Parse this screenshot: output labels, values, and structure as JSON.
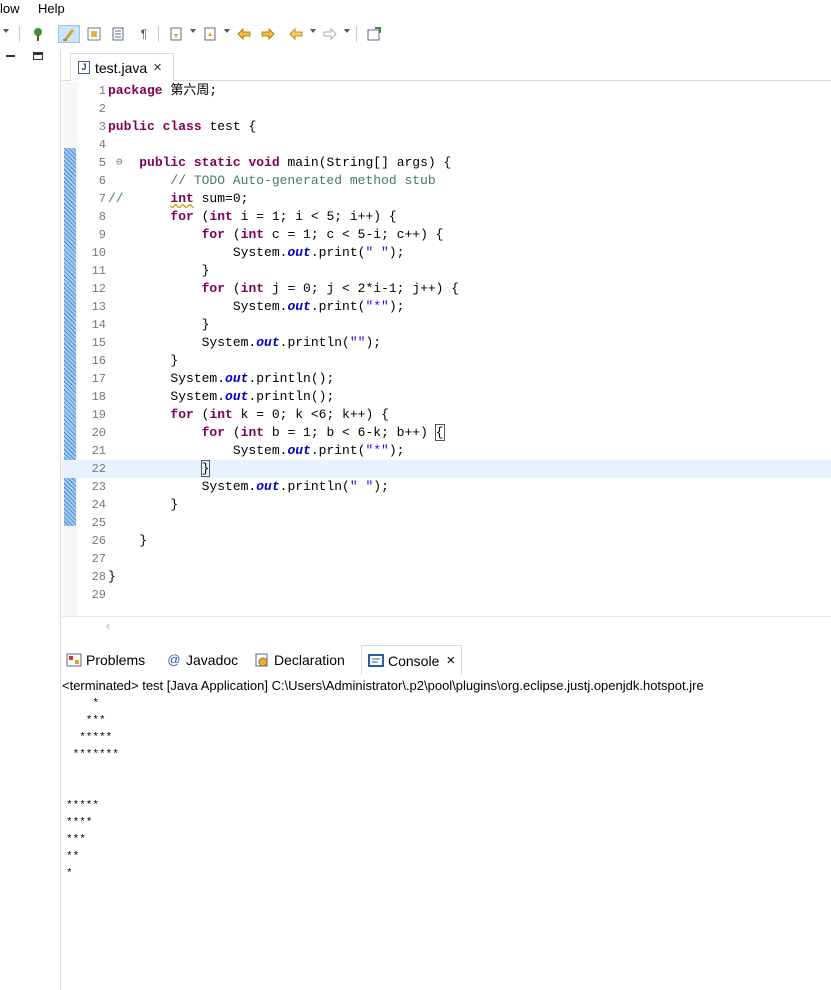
{
  "menu": {
    "items": [
      "low",
      "Help"
    ]
  },
  "editor_tab": {
    "title": "test.java",
    "close": "×"
  },
  "code_lines": [
    {
      "n": "1"
    },
    {
      "n": "2"
    },
    {
      "n": "3"
    },
    {
      "n": "4"
    },
    {
      "n": "5"
    },
    {
      "n": "6"
    },
    {
      "n": "7"
    },
    {
      "n": "8"
    },
    {
      "n": "9"
    },
    {
      "n": "10"
    },
    {
      "n": "11"
    },
    {
      "n": "12"
    },
    {
      "n": "13"
    },
    {
      "n": "14"
    },
    {
      "n": "15"
    },
    {
      "n": "16"
    },
    {
      "n": "17"
    },
    {
      "n": "18"
    },
    {
      "n": "19"
    },
    {
      "n": "20"
    },
    {
      "n": "21"
    },
    {
      "n": "22"
    },
    {
      "n": "23"
    },
    {
      "n": "24"
    },
    {
      "n": "25"
    },
    {
      "n": "26"
    },
    {
      "n": "27"
    },
    {
      "n": "28"
    },
    {
      "n": "29"
    }
  ],
  "code": {
    "l1a": "package",
    "l1b": " 第六周;",
    "l3a": "public",
    "l3b": " ",
    "l3c": "class",
    "l3d": " test {",
    "l5a": "    ",
    "l5b": "public",
    "l5c": " ",
    "l5d": "static",
    "l5e": " ",
    "l5f": "void",
    "l5g": " main(String[] args) {",
    "l6": "        // TODO Auto-generated method stub",
    "l7a": "//      ",
    "l7b": "int",
    "l7c": " sum=0;",
    "for": "for",
    "int": "int",
    "l8": " i = 1; i < 5; i++) {",
    "l9": " c = 1; c < 5-i; c++) {",
    "sys": "System.",
    "out": "out",
    "l10s": "\" \"",
    "l12": " j = 0; j < 2*i-1; j++) {",
    "l13s": "\"*\"",
    "l15s": "\"\"",
    "l19": " k = 0; k <6; k++) {",
    "l20": " b = 1; b < 6-k; b++) ",
    "l21s": "\"*\"",
    "l23s": "\" \"",
    "print": ".print(",
    "println": ".println(",
    "printlnE": ".println();",
    "close": ");",
    "brace": "}",
    "brace_open": "{",
    "for_open": " (",
    "l26": "    }",
    "l28": "}"
  },
  "bottom_tabs": {
    "problems": "Problems",
    "javadoc": "Javadoc",
    "declaration": "Declaration",
    "console": "Console",
    "close": "×"
  },
  "console": {
    "header": "<terminated> test [Java Application] C:\\Users\\Administrator\\.p2\\pool\\plugins\\org.eclipse.justj.openjdk.hotspot.jre",
    "output": [
      "    *",
      "   ***",
      "  *****",
      " *******",
      "",
      "",
      "*****",
      "****",
      "***",
      "**",
      "*"
    ]
  },
  "colors": {
    "keyword": "#7f0055",
    "comment": "#3f7f5f",
    "string": "#2a00ff",
    "field": "#0000c0",
    "current_line": "#e8f2fe"
  }
}
